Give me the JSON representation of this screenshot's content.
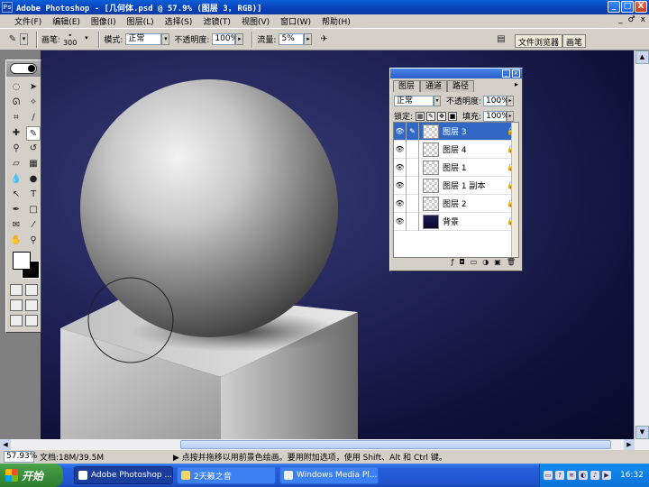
{
  "window": {
    "title": "Adobe Photoshop - [几何体.psd @ 57.9% (图层 3, RGB)]",
    "app_icon_text": "Ps",
    "buttons": {
      "minimize": "_",
      "maximize": "□",
      "close": "X"
    }
  },
  "menu": {
    "items": [
      "文件(F)",
      "编辑(E)",
      "图像(I)",
      "图层(L)",
      "选择(S)",
      "滤镜(T)",
      "视图(V)",
      "窗口(W)",
      "帮助(H)"
    ],
    "doc_controls": [
      "_",
      "♂",
      "x"
    ]
  },
  "options": {
    "brush_label": "画笔:",
    "brush_size": "300",
    "mode_label": "模式:",
    "mode_value": "正常",
    "opacity_label": "不透明度:",
    "opacity_value": "100%",
    "flow_label": "流量:",
    "flow_value": "5%",
    "tabs": [
      "文件浏览器",
      "画笔"
    ]
  },
  "layers_panel": {
    "tabs": [
      "图层",
      "通道",
      "路径"
    ],
    "blend_mode": "正常",
    "opacity_label": "不透明度:",
    "opacity_value": "100%",
    "lock_label": "锁定:",
    "fill_label": "填充:",
    "fill_value": "100%",
    "layers": [
      {
        "name": "图层 3",
        "selected": true,
        "thumb": "sphere"
      },
      {
        "name": "图层 4",
        "selected": false,
        "thumb": "transparent"
      },
      {
        "name": "图层 1",
        "selected": false,
        "thumb": "transparent"
      },
      {
        "name": "图层 1 副本",
        "selected": false,
        "thumb": "transparent"
      },
      {
        "name": "图层 2",
        "selected": false,
        "thumb": "transparent"
      },
      {
        "name": "背景",
        "selected": false,
        "thumb": "background"
      }
    ]
  },
  "status": {
    "zoom": "57.93%",
    "doc": "文档:18M/39.5M",
    "tip": "▶ 点按并拖移以用前景色绘画。要用附加选项，使用 Shift、Alt 和 Ctrl 键。"
  },
  "taskbar": {
    "start": "开始",
    "tasks": [
      "Adobe Photoshop ...",
      "2天籁之音",
      "Windows Media Pl..."
    ],
    "clock": "16:32"
  },
  "colors": {
    "canvas_bg": "#1a1c52",
    "title_blue": "#0a5fd8",
    "selected_layer": "#3168c6"
  }
}
